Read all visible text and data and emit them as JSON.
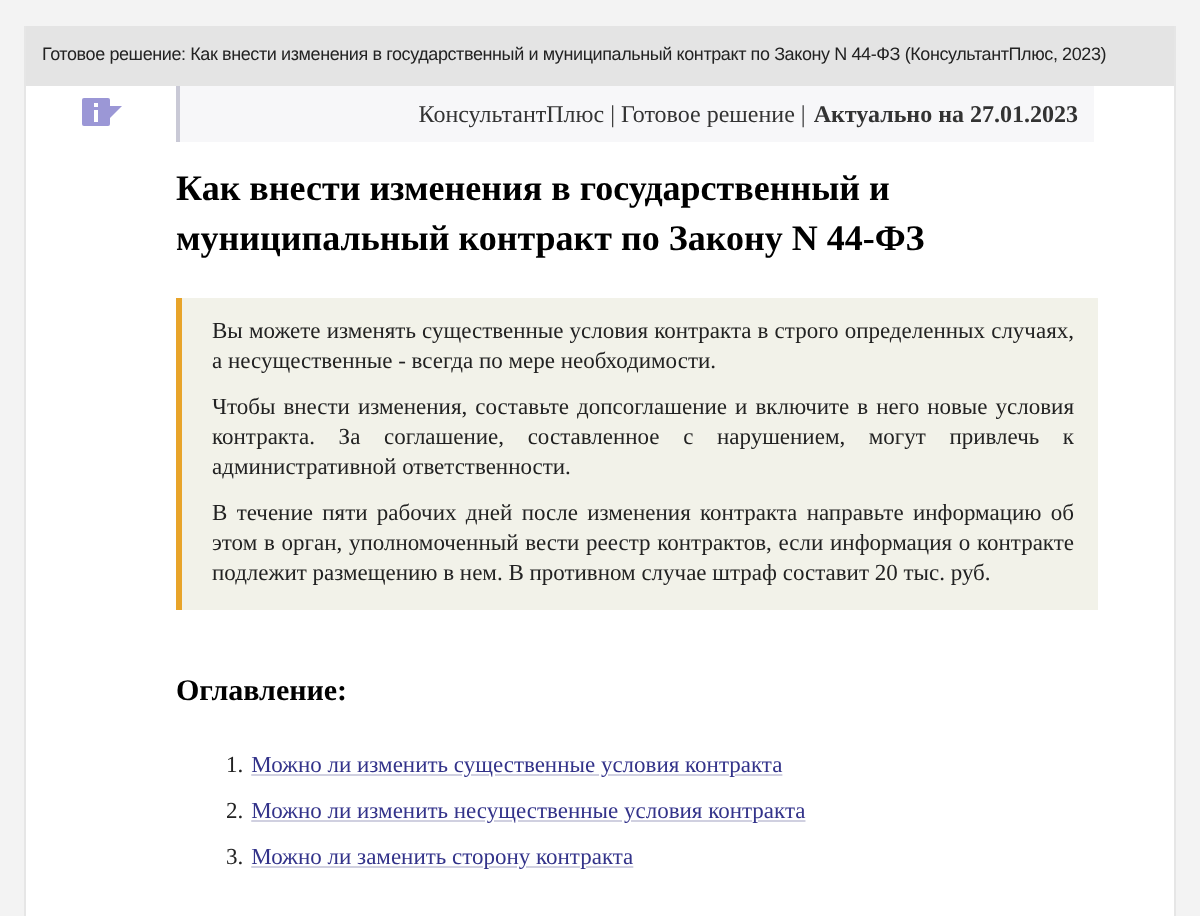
{
  "window": {
    "title": "Готовое решение: Как внести изменения в государственный и муниципальный контракт по Закону N 44-ФЗ (КонсультантПлюс, 2023)"
  },
  "header": {
    "source": "КонсультантПлюс | Готовое решение | ",
    "actuality": "Актуально на 27.01.2023"
  },
  "heading": "Как внести изменения в государственный и муниципальный контракт по Закону N 44-ФЗ",
  "summary": [
    "Вы можете изменять существенные условия контракта в строго определенных случаях, а несущественные - всегда по мере необходимости.",
    "Чтобы внести изменения, составьте допсоглашение и включите в него новые условия контракта. За соглашение, составленное с нарушением, могут привлечь к административной ответственности.",
    "В течение пяти рабочих дней после изменения контракта направьте информацию об этом в орган, уполномоченный вести реестр контрактов, если информация о контракте подлежит размещению в нем. В противном случае штраф составит 20 тыс. руб."
  ],
  "contents": {
    "title": "Оглавление:",
    "items": [
      {
        "number": "1.",
        "label": "Можно ли изменить существенные условия контракта"
      },
      {
        "number": "2.",
        "label": "Можно ли изменить несущественные условия контракта"
      },
      {
        "number": "3.",
        "label": "Можно ли заменить сторону контракта"
      }
    ]
  }
}
